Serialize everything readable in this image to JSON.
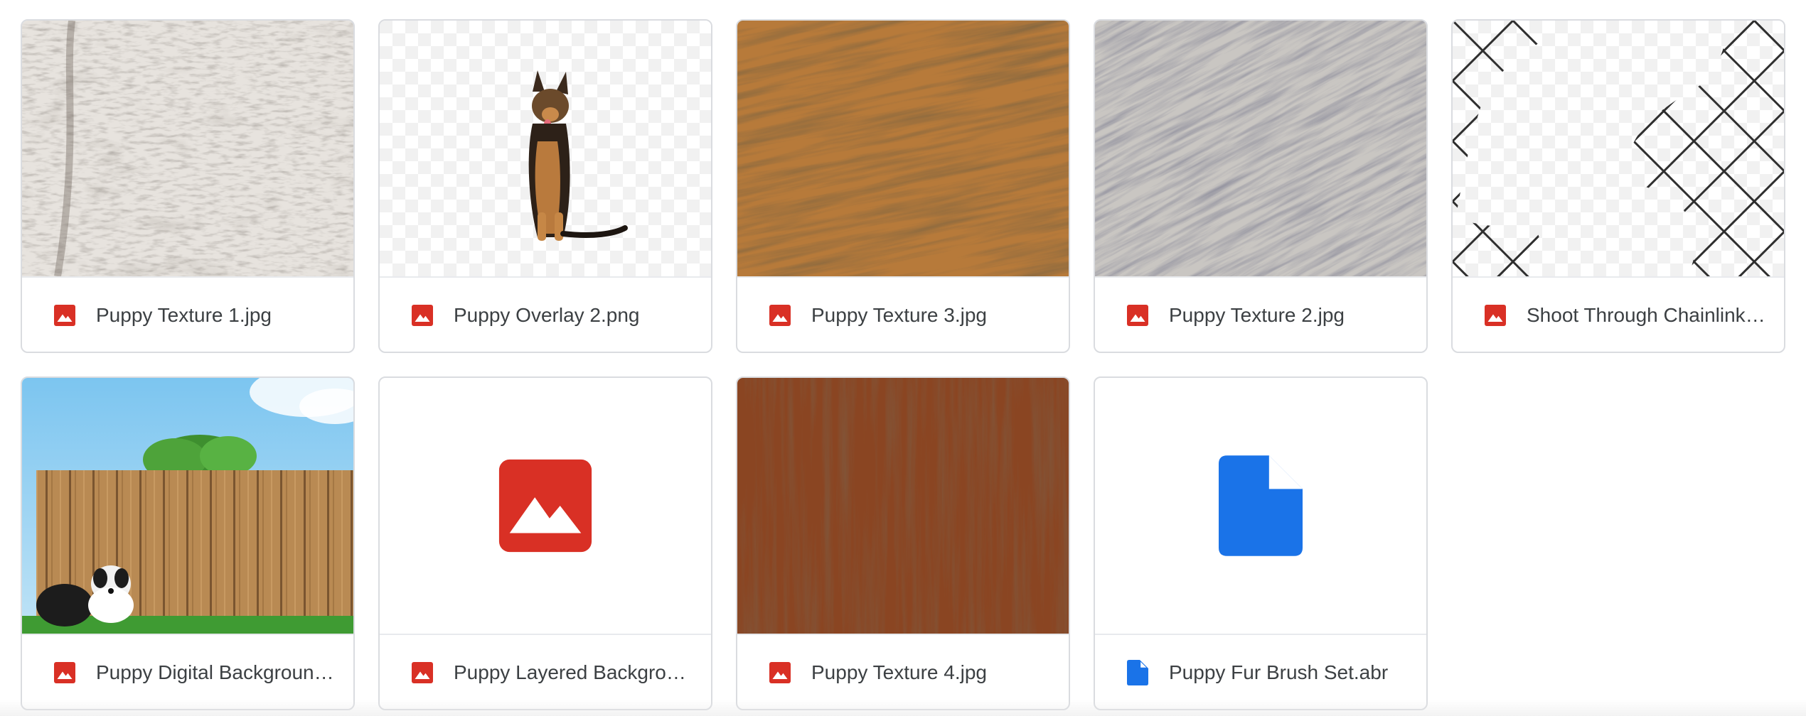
{
  "files": [
    {
      "name": "Puppy Texture 1.jpg",
      "type": "image",
      "thumb": "fur-gray"
    },
    {
      "name": "Puppy Overlay 2.png",
      "type": "image",
      "thumb": "puppy-overlay"
    },
    {
      "name": "Puppy Texture 3.jpg",
      "type": "image",
      "thumb": "fur-golden"
    },
    {
      "name": "Puppy Texture 2.jpg",
      "type": "image",
      "thumb": "fur-silver"
    },
    {
      "name": "Shoot Through Chainlink Overlay.png",
      "type": "image",
      "thumb": "chainlink"
    },
    {
      "name": "Puppy Digital Background.jpg",
      "type": "image",
      "thumb": "fence-puppy"
    },
    {
      "name": "Puppy Layered Background.psd",
      "type": "image",
      "thumb": "generic-image"
    },
    {
      "name": "Puppy Texture 4.jpg",
      "type": "image",
      "thumb": "fur-brown"
    },
    {
      "name": "Puppy Fur Brush Set.abr",
      "type": "file",
      "thumb": "generic-file"
    }
  ],
  "icons": {
    "image": "image-file-icon",
    "file": "document-file-icon"
  },
  "colors": {
    "image_icon": "#d93025",
    "file_icon": "#1a73e8",
    "text": "#3c4043",
    "border": "#dadce0"
  }
}
